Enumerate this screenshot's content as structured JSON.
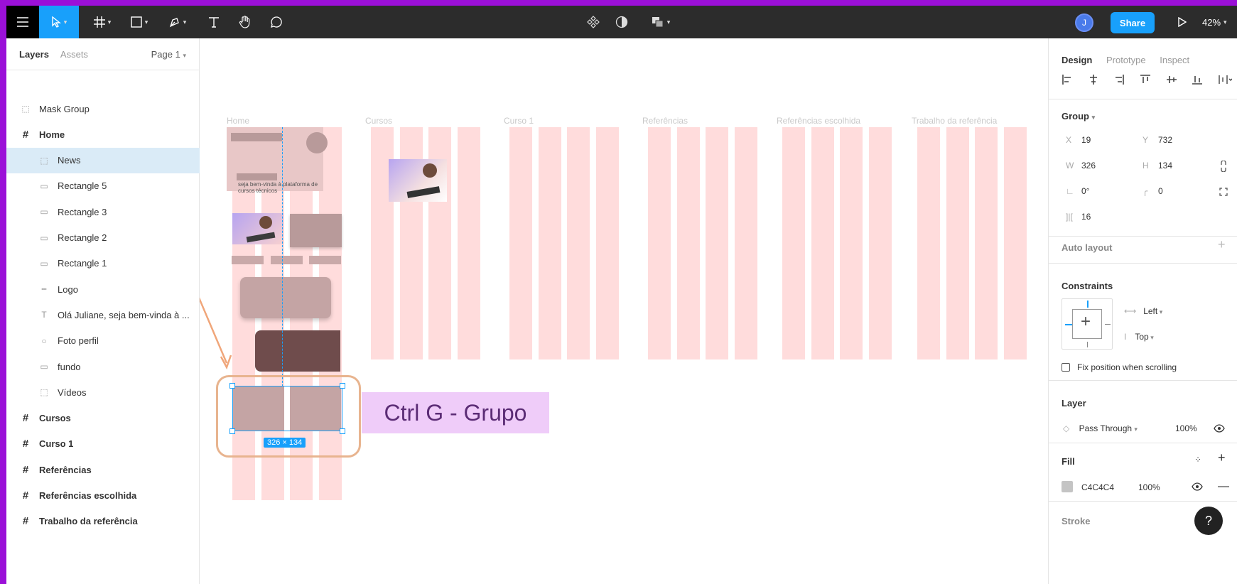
{
  "toolbar": {
    "zoom": "42%",
    "share_label": "Share",
    "avatar_initial": "J"
  },
  "left_panel": {
    "tabs": [
      "Layers",
      "Assets"
    ],
    "page": "Page 1",
    "layers": [
      {
        "label": "Mask Group",
        "type": "group",
        "indent": 0
      },
      {
        "label": "Home",
        "type": "frame",
        "indent": 0
      },
      {
        "label": "News",
        "type": "group",
        "indent": 1,
        "selected": true
      },
      {
        "label": "Rectangle 5",
        "type": "rect",
        "indent": 1
      },
      {
        "label": "Rectangle 3",
        "type": "rect",
        "indent": 1
      },
      {
        "label": "Rectangle 2",
        "type": "rect",
        "indent": 1
      },
      {
        "label": "Rectangle 1",
        "type": "rect",
        "indent": 1
      },
      {
        "label": "Logo",
        "type": "line",
        "indent": 1
      },
      {
        "label": "Olá Juliane, seja bem-vinda à ...",
        "type": "text",
        "indent": 1
      },
      {
        "label": "Foto perfil",
        "type": "ellipse",
        "indent": 1
      },
      {
        "label": "fundo",
        "type": "rect",
        "indent": 1
      },
      {
        "label": "Vídeos",
        "type": "group",
        "indent": 1
      },
      {
        "label": "Cursos",
        "type": "frame",
        "indent": 0
      },
      {
        "label": "Curso 1",
        "type": "frame",
        "indent": 0
      },
      {
        "label": "Referências",
        "type": "frame",
        "indent": 0
      },
      {
        "label": "Referências escolhida",
        "type": "frame",
        "indent": 0
      },
      {
        "label": "Trabalho da referência",
        "type": "frame",
        "indent": 0
      }
    ]
  },
  "canvas": {
    "frame_labels": [
      "Home",
      "Cursos",
      "Curso 1",
      "Referências",
      "Referências escolhida",
      "Trabalho da referência"
    ],
    "home_text": "seja bem-vinda à plataforma de cursos técnicos",
    "selection_size": "326 × 134",
    "annotation": "Ctrl G - Grupo"
  },
  "right_panel": {
    "tabs": [
      "Design",
      "Prototype",
      "Inspect"
    ],
    "group_label": "Group",
    "x": "19",
    "y": "732",
    "w": "326",
    "h": "134",
    "rotation": "0°",
    "radius": "0",
    "spacing": "16",
    "auto_layout": "Auto layout",
    "constraints_title": "Constraints",
    "constraint_h": "Left",
    "constraint_v": "Top",
    "fix_position": "Fix position when scrolling",
    "layer_title": "Layer",
    "blend": "Pass Through",
    "layer_opacity": "100%",
    "fill_title": "Fill",
    "fill_hex": "C4C4C4",
    "fill_opacity": "100%",
    "stroke_title": "Stroke",
    "colors": {
      "fill_swatch": "#c4c4c4",
      "accent": "#18a0fb"
    }
  },
  "help_label": "?"
}
